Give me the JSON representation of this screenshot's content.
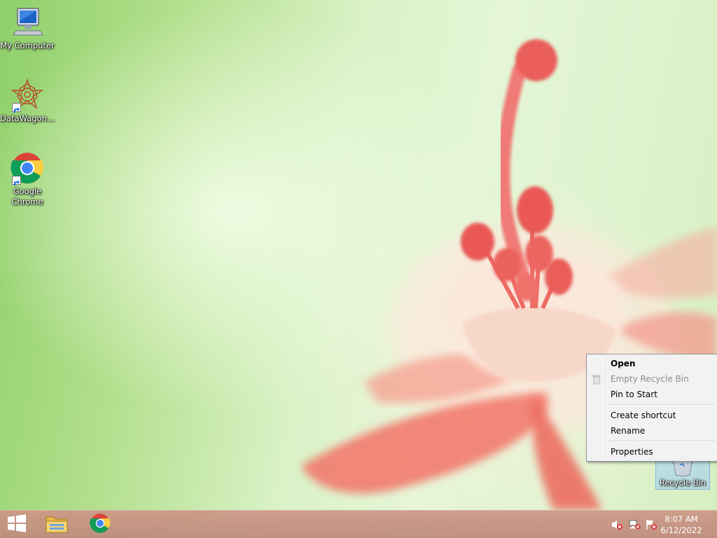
{
  "desktop": {
    "icons": [
      {
        "label": "My Computer",
        "icon": "computer-icon"
      },
      {
        "label": "DataWagon...",
        "icon": "datawagon-icon",
        "shortcut": true
      },
      {
        "label": "Google Chrome",
        "icon": "chrome-icon",
        "shortcut": true
      },
      {
        "label": "Recycle Bin",
        "icon": "recycle-bin-icon",
        "selected": true
      }
    ]
  },
  "context_menu": {
    "items": [
      {
        "label": "Open",
        "bold": true
      },
      {
        "label": "Empty Recycle Bin",
        "disabled": true,
        "icon": "empty-recycle-bin-icon"
      },
      {
        "label": "Pin to Start"
      },
      {
        "label": "Create shortcut"
      },
      {
        "label": "Rename"
      },
      {
        "label": "Properties"
      }
    ]
  },
  "taskbar": {
    "start_icon": "windows-logo-icon",
    "pinned": [
      {
        "name": "File Explorer",
        "icon": "folder-icon"
      },
      {
        "name": "Google Chrome",
        "icon": "chrome-icon"
      }
    ],
    "tray": [
      {
        "icon": "speaker-muted-icon"
      },
      {
        "icon": "network-disconnected-icon"
      },
      {
        "icon": "action-center-flag-icon"
      }
    ],
    "clock": {
      "time": "8:07 AM",
      "date": "6/12/2022"
    }
  },
  "colors": {
    "taskbar": "#c48e7f",
    "menu_background": "#f2f2f2",
    "selection": "#a0cdf5"
  }
}
